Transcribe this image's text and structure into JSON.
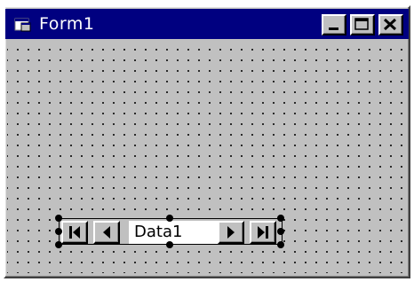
{
  "window": {
    "title": "Form1"
  },
  "caption_buttons": {
    "minimize": "minimize-icon",
    "maximize": "maximize-icon",
    "close": "close-icon"
  },
  "data_control": {
    "caption": "Data1",
    "buttons": [
      "first-record-icon",
      "previous-record-icon",
      "next-record-icon",
      "last-record-icon"
    ]
  },
  "colors": {
    "titlebar": "#000080",
    "face": "#c0c0c0",
    "grid_dot": "#000000"
  }
}
